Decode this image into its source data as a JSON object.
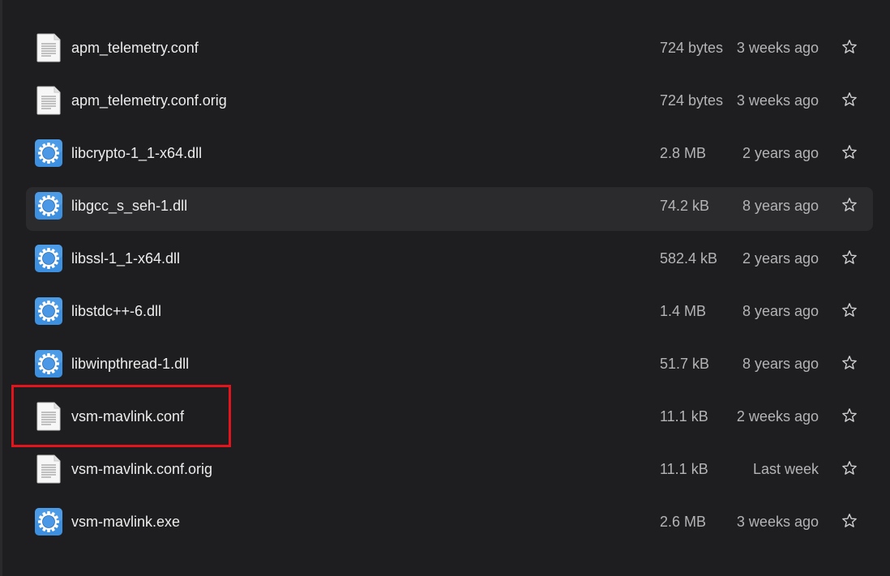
{
  "files": [
    {
      "name": "apm_telemetry.conf",
      "size": "724 bytes",
      "modified": "3 weeks ago",
      "icon": "text-document-icon"
    },
    {
      "name": "apm_telemetry.conf.orig",
      "size": "724 bytes",
      "modified": "3 weeks ago",
      "icon": "text-document-icon"
    },
    {
      "name": "libcrypto-1_1-x64.dll",
      "size": "2.8 MB",
      "modified": "2 years ago",
      "icon": "executable-gear-icon"
    },
    {
      "name": "libgcc_s_seh-1.dll",
      "size": "74.2 kB",
      "modified": "8 years ago",
      "icon": "executable-gear-icon"
    },
    {
      "name": "libssl-1_1-x64.dll",
      "size": "582.4 kB",
      "modified": "2 years ago",
      "icon": "executable-gear-icon"
    },
    {
      "name": "libstdc++-6.dll",
      "size": "1.4 MB",
      "modified": "8 years ago",
      "icon": "executable-gear-icon"
    },
    {
      "name": "libwinpthread-1.dll",
      "size": "51.7 kB",
      "modified": "8 years ago",
      "icon": "executable-gear-icon"
    },
    {
      "name": "vsm-mavlink.conf",
      "size": "11.1 kB",
      "modified": "2 weeks ago",
      "icon": "text-document-icon"
    },
    {
      "name": "vsm-mavlink.conf.orig",
      "size": "11.1 kB",
      "modified": "Last week",
      "icon": "text-document-icon"
    },
    {
      "name": "vsm-mavlink.exe",
      "size": "2.6 MB",
      "modified": "3 weeks ago",
      "icon": "executable-gear-icon"
    }
  ],
  "hovered_row": "libgcc_s_seh-1.dll",
  "highlighted_row": "vsm-mavlink.conf",
  "colors": {
    "background": "#1e1e20",
    "hover_background": "#2b2b2e",
    "highlight_border": "#e3141b",
    "name_text": "#ececec",
    "meta_text": "#b4b4b6"
  }
}
